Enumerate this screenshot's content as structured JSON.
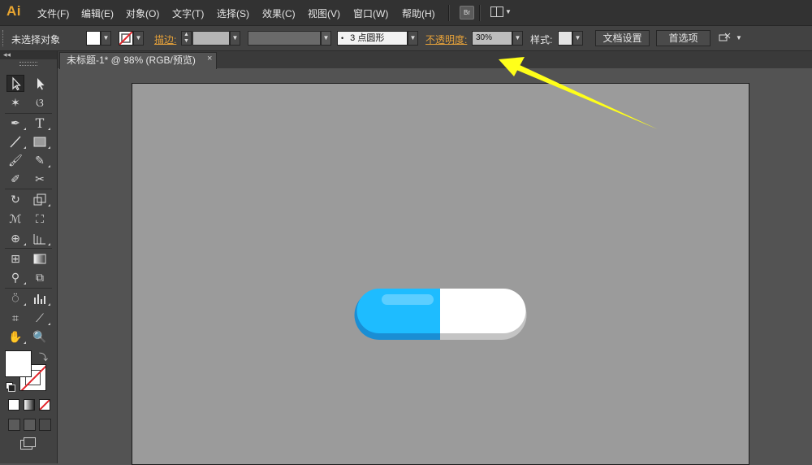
{
  "menubar": {
    "logo": "Ai",
    "items": [
      "文件(F)",
      "编辑(E)",
      "对象(O)",
      "文字(T)",
      "选择(S)",
      "效果(C)",
      "视图(V)",
      "窗口(W)",
      "帮助(H)"
    ],
    "bridge_label": "Br"
  },
  "controlbar": {
    "selection_status": "未选择对象",
    "stroke_label": "描边:",
    "brush_label": "3 点圆形",
    "opacity_label": "不透明度:",
    "opacity_value": "30%",
    "style_label": "样式:",
    "doc_setup_label": "文档设置",
    "preferences_label": "首选项"
  },
  "document": {
    "tab_title": "未标题-1* @ 98% (RGB/预览)",
    "close_glyph": "×"
  },
  "canvas": {
    "pill_left_color": "#1ebcff",
    "pill_right_color": "#ffffff",
    "pill_shadow_left": "#1a8ed4",
    "pill_shadow_right": "#c4c4c4",
    "annotation_arrow_color": "#ffff1a"
  },
  "colors": {
    "accent_link": "#e6a23a",
    "app_logo": "#e8a530",
    "no_fill_red": "#e2242a"
  }
}
